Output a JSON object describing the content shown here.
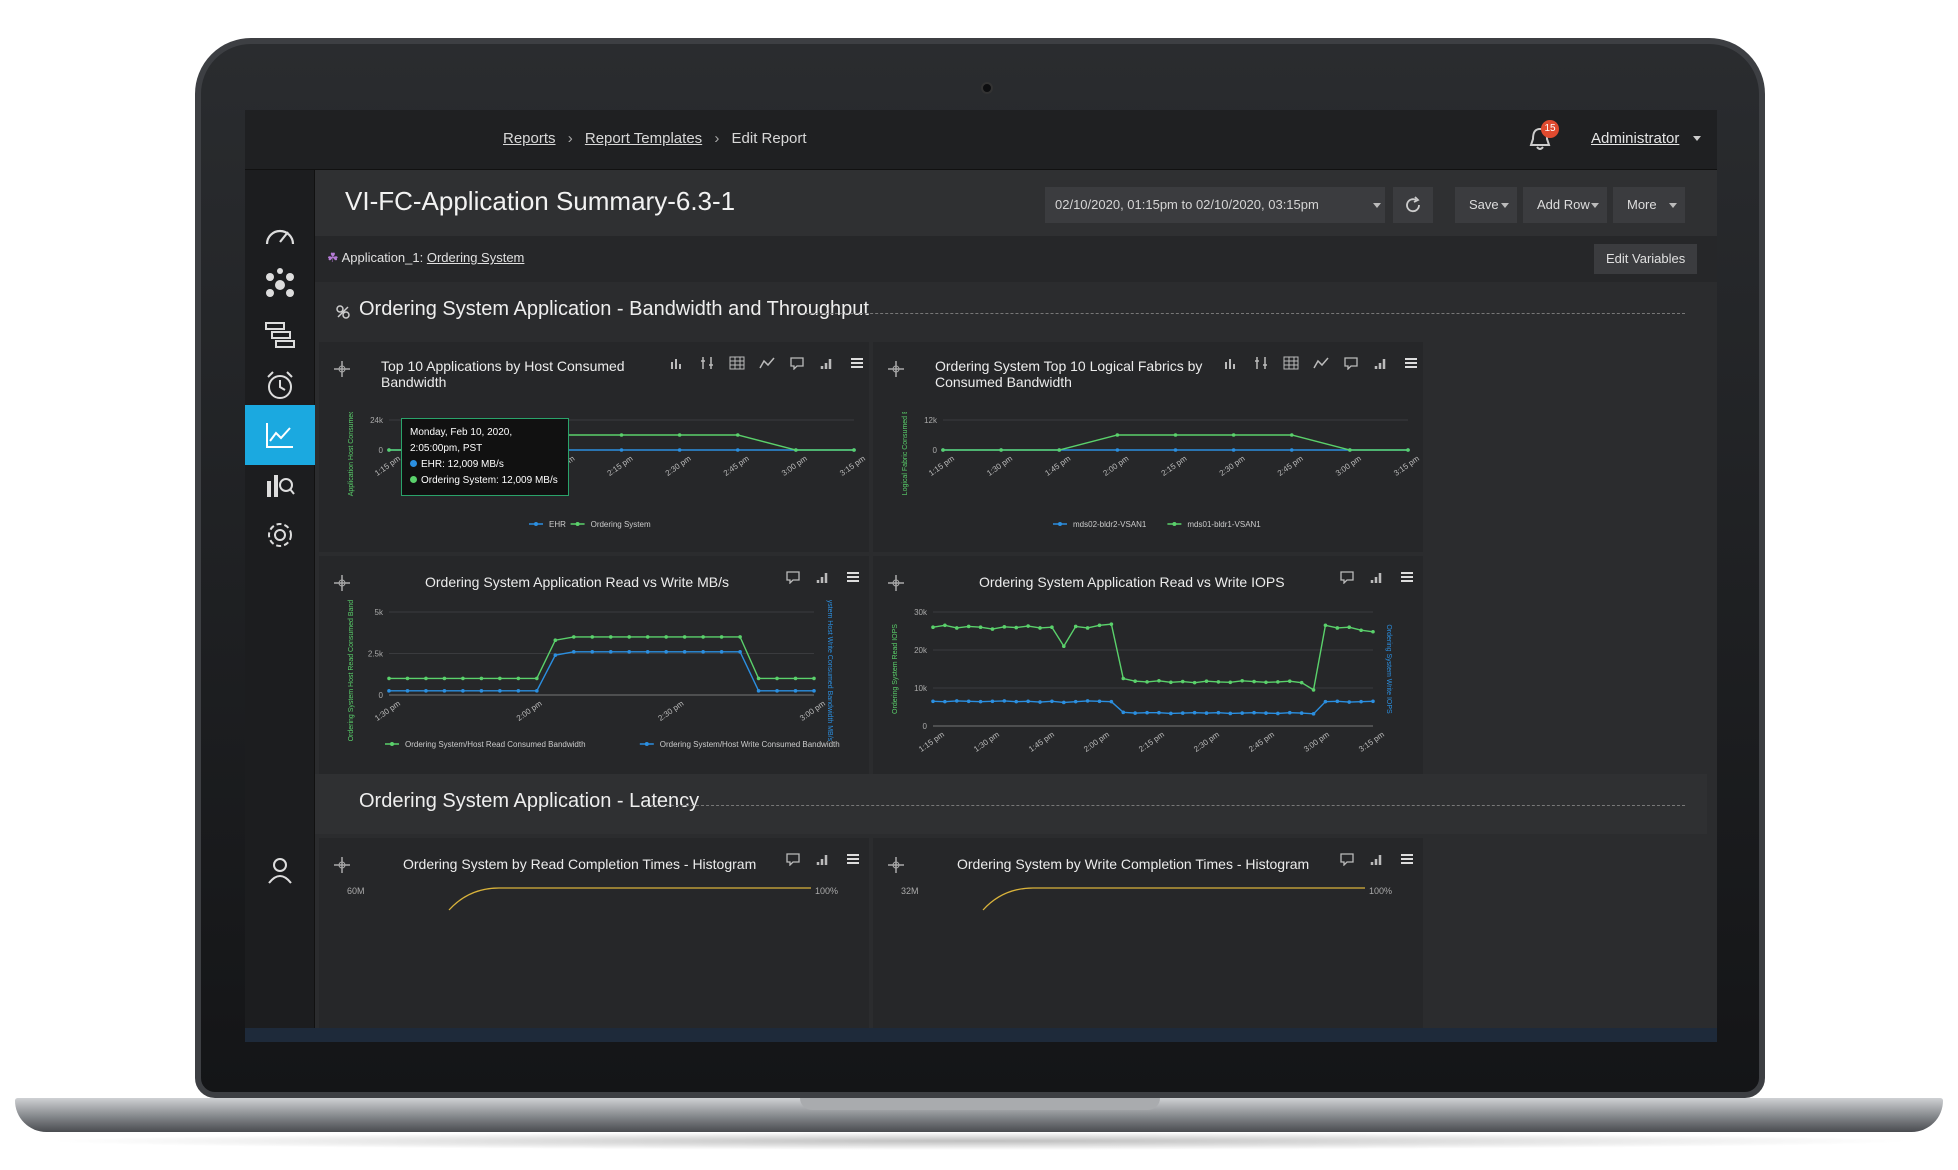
{
  "breadcrumb": {
    "items": [
      "Reports",
      "Report Templates",
      "Edit Report"
    ]
  },
  "notifications": {
    "count": "15"
  },
  "user": {
    "name": "Administrator"
  },
  "page": {
    "title": "VI-FC-Application Summary-6.3-1"
  },
  "toolbar": {
    "date_range": "02/10/2020, 01:15pm to 02/10/2020, 03:15pm",
    "save": "Save",
    "add_row": "Add Row",
    "more": "More"
  },
  "variables": {
    "label": "Application_1:",
    "value": "Ordering System",
    "edit": "Edit Variables"
  },
  "sections": [
    {
      "title": "Ordering System Application - Bandwidth and Throughput"
    },
    {
      "title": "Ordering System Application - Latency"
    }
  ],
  "panels": {
    "p1": {
      "title": "Top 10 Applications by Host Consumed Bandwidth"
    },
    "p2": {
      "title": "Ordering System Top 10 Logical Fabrics by Consumed Bandwidth"
    },
    "p3": {
      "title": "Ordering System Application Read vs Write MB/s"
    },
    "p4": {
      "title": "Ordering System Application Read vs Write IOPS"
    },
    "p5": {
      "title": "Ordering System by Read Completion Times - Histogram"
    },
    "p6": {
      "title": "Ordering System by Write Completion Times - Histogram"
    }
  },
  "tooltip": {
    "time": "Monday, Feb 10, 2020, 2:05:00pm, PST",
    "ehr": "EHR: 12,009 MB/s",
    "ordering": "Ordering System: 12,009 MB/s"
  },
  "colors": {
    "green": "#5ad16b",
    "blue": "#2b8fe0",
    "accent": "#1ba9e0"
  },
  "chart_data": [
    {
      "type": "line",
      "title": "Top 10 Applications by Host Consumed Bandwidth",
      "ylabel": "Application Host Consumed Band MB/s",
      "y_ticks": [
        "0",
        "24k"
      ],
      "ylim": [
        0,
        24000
      ],
      "categories": [
        "1:15 pm",
        "1:30 pm",
        "1:45 pm",
        "2:00 pm",
        "2:15 pm",
        "2:30 pm",
        "2:45 pm",
        "3:00 pm",
        "3:15 pm"
      ],
      "series": [
        {
          "name": "EHR",
          "color": "#2b8fe0",
          "values": [
            0,
            0,
            0,
            0,
            0,
            0,
            0,
            0,
            0
          ]
        },
        {
          "name": "Ordering System",
          "color": "#5ad16b",
          "values": [
            0,
            0,
            0,
            12009,
            12009,
            12009,
            12009,
            0,
            0
          ]
        }
      ]
    },
    {
      "type": "line",
      "title": "Ordering System Top 10 Logical Fabrics by Consumed Bandwidth",
      "ylabel": "Logical Fabric Consumed Bandw MB/s",
      "y_ticks": [
        "0",
        "12k"
      ],
      "ylim": [
        0,
        12000
      ],
      "categories": [
        "1:15 pm",
        "1:30 pm",
        "1:45 pm",
        "2:00 pm",
        "2:15 pm",
        "2:30 pm",
        "2:45 pm",
        "3:00 pm",
        "3:15 pm"
      ],
      "series": [
        {
          "name": "mds02-bldr2-VSAN1",
          "color": "#2b8fe0",
          "values": [
            0,
            0,
            0,
            0,
            0,
            0,
            0,
            0,
            0
          ]
        },
        {
          "name": "mds01-bldr1-VSAN1",
          "color": "#5ad16b",
          "values": [
            0,
            0,
            0,
            6000,
            6000,
            6000,
            6000,
            0,
            0
          ]
        }
      ]
    },
    {
      "type": "line",
      "title": "Ordering System Application Read vs Write MB/s",
      "ylabel": "Ordering System Host Read Consumed Bandwidth MB/s",
      "y2label": "Ordering System Host Write Consumed Bandwidth MB/s",
      "y_ticks": [
        "0",
        "2.5k",
        "5k"
      ],
      "ylim": [
        0,
        5000
      ],
      "x_ticks": [
        "1:30 pm",
        "2:00 pm",
        "2:30 pm",
        "3:00 pm"
      ],
      "series": [
        {
          "name": "Ordering System/Host Read Consumed Bandwidth",
          "color": "#5ad16b",
          "values": [
            1000,
            1000,
            1000,
            1000,
            1000,
            1000,
            1000,
            1000,
            1000,
            3300,
            3500,
            3500,
            3500,
            3500,
            3500,
            3500,
            3500,
            3500,
            3500,
            3500,
            1000,
            1000,
            1000,
            1000
          ]
        },
        {
          "name": "Ordering System/Host Write Consumed Bandwidth",
          "color": "#2b8fe0",
          "values": [
            250,
            250,
            250,
            250,
            250,
            250,
            250,
            250,
            250,
            2400,
            2600,
            2600,
            2600,
            2600,
            2600,
            2600,
            2600,
            2600,
            2600,
            2600,
            250,
            250,
            250,
            250
          ]
        }
      ]
    },
    {
      "type": "line",
      "title": "Ordering System Application Read vs Write IOPS",
      "ylabel": "Ordering System Read IOPS",
      "y2label": "Ordering System Write IOPS",
      "y_ticks": [
        "0",
        "10k",
        "20k",
        "30k"
      ],
      "ylim": [
        0,
        30000
      ],
      "x_ticks": [
        "1:15 pm",
        "1:30 pm",
        "1:45 pm",
        "2:00 pm",
        "2:15 pm",
        "2:30 pm",
        "2:45 pm",
        "3:00 pm",
        "3:15 pm"
      ],
      "series": [
        {
          "name": "Read IOPS",
          "color": "#5ad16b",
          "values": [
            26000,
            26500,
            25800,
            26200,
            26000,
            25500,
            26100,
            25900,
            26300,
            25800,
            26000,
            21000,
            26200,
            25800,
            26500,
            26800,
            12500,
            11800,
            11600,
            11900,
            11500,
            11700,
            11400,
            11800,
            11600,
            11500,
            11900,
            11700,
            11500,
            11600,
            11800,
            11400,
            9500,
            26500,
            25800,
            26000,
            25200,
            24800
          ]
        },
        {
          "name": "Write IOPS",
          "color": "#2b8fe0",
          "values": [
            6500,
            6400,
            6600,
            6500,
            6400,
            6500,
            6600,
            6400,
            6500,
            6300,
            6500,
            6200,
            6400,
            6600,
            6500,
            6400,
            3600,
            3400,
            3500,
            3500,
            3300,
            3400,
            3500,
            3400,
            3500,
            3300,
            3400,
            3500,
            3400,
            3300,
            3500,
            3400,
            3200,
            6400,
            6500,
            6300,
            6400,
            6500
          ]
        }
      ]
    }
  ],
  "histograms": {
    "read": {
      "y_left": "60M",
      "y_right": "100%"
    },
    "write": {
      "y_left": "32M",
      "y_right": "100%"
    }
  }
}
